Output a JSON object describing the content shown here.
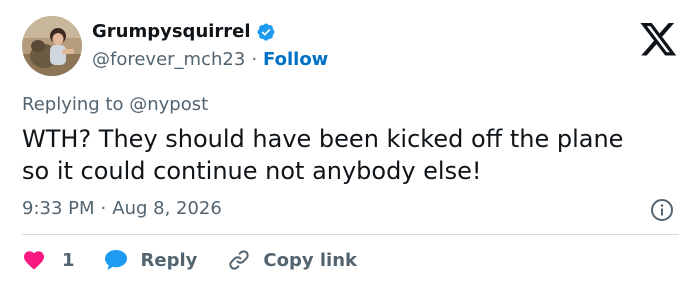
{
  "user": {
    "display_name": "Grumpysquirrel",
    "handle": "@forever_mch23",
    "separator": "·",
    "follow_label": "Follow",
    "verified": true
  },
  "reply_context": {
    "prefix": "Replying to ",
    "mention": "@nypost"
  },
  "tweet": {
    "text": "WTH? They should have been kicked off the plane\nso it could continue not anybody else!",
    "time": "9:33 PM",
    "separator": "·",
    "date": "Aug 8, 2026"
  },
  "actions": {
    "like_count": "1",
    "reply_label": "Reply",
    "copy_label": "Copy link"
  },
  "colors": {
    "text": "#0f1419",
    "secondary": "#536471",
    "link": "#0072c6",
    "verified": "#1d9bf0",
    "like": "#f91880",
    "reply": "#1d9bf0",
    "divider": "#cfd9de"
  },
  "icons": {
    "verified": "verified-badge-icon",
    "logo": "x-logo-icon",
    "info": "info-icon",
    "like": "heart-icon",
    "reply": "speech-bubble-icon",
    "copy": "link-icon"
  }
}
